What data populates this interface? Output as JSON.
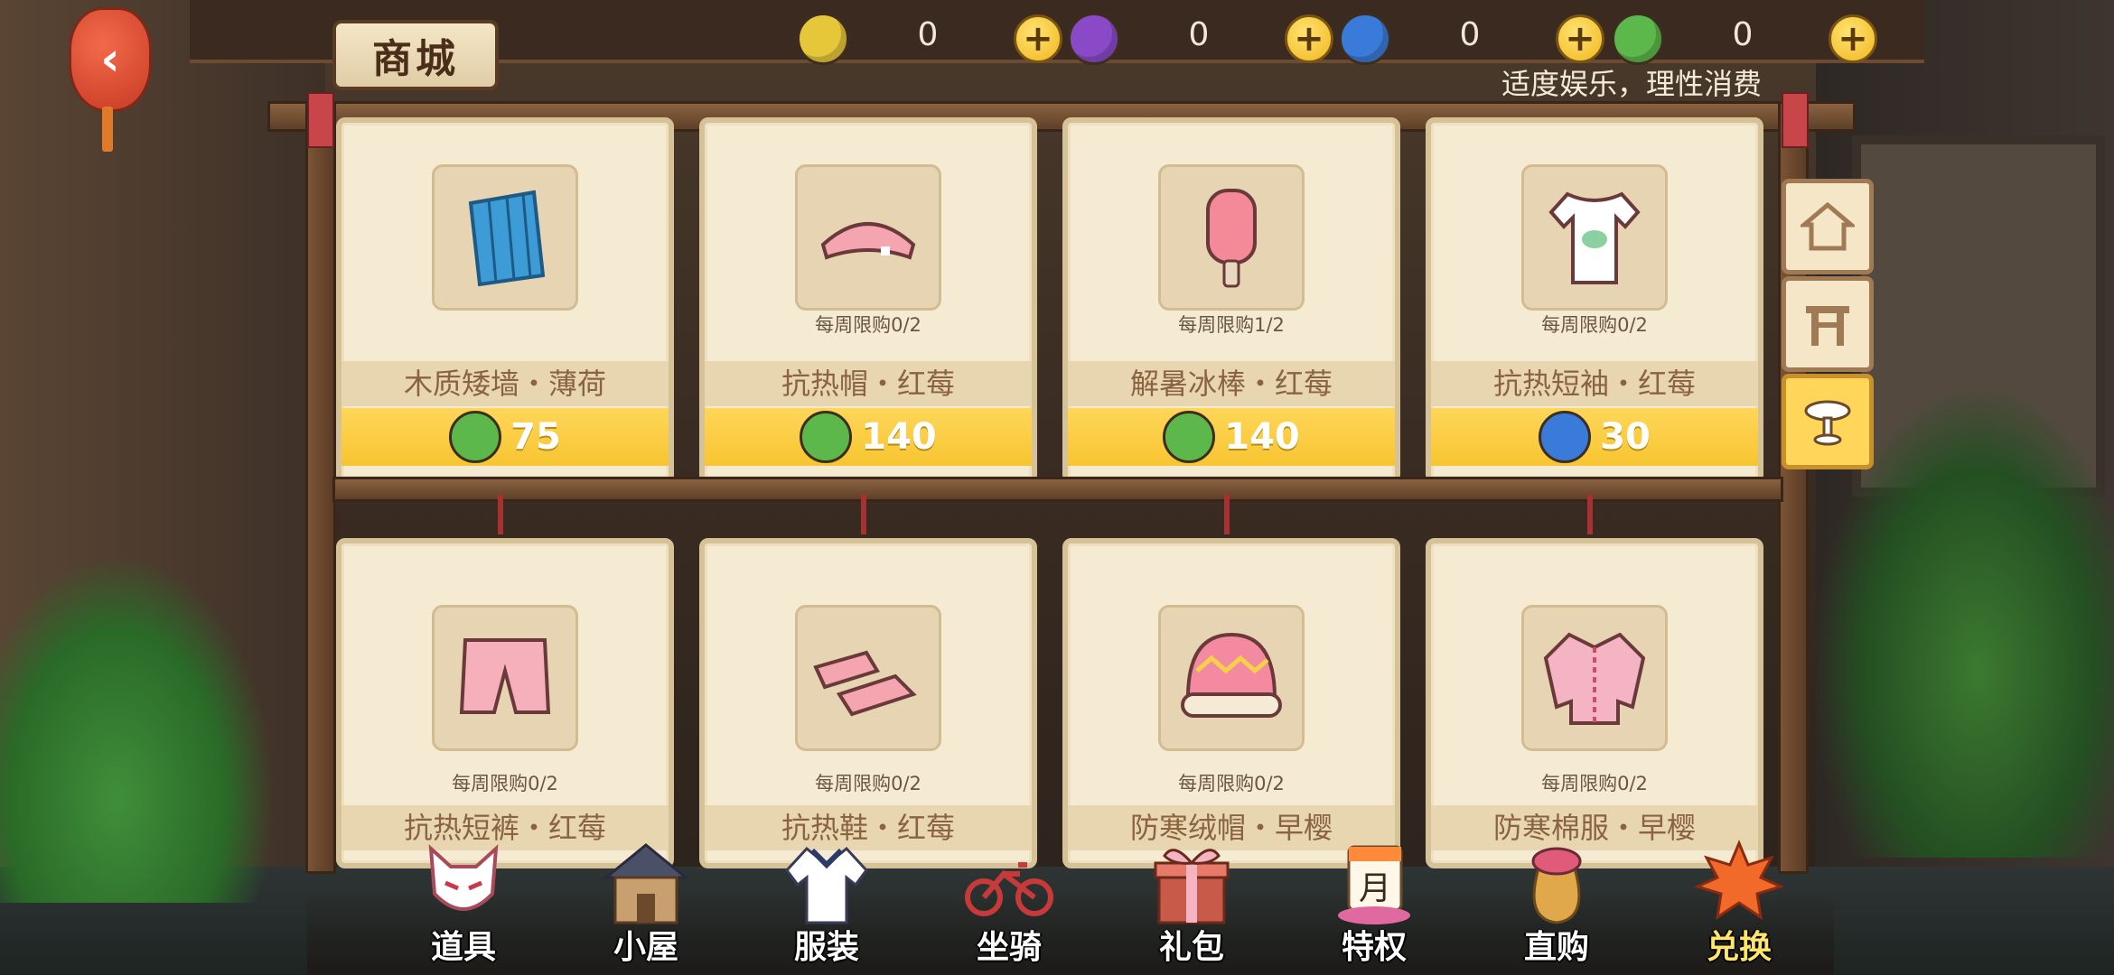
{
  "page_title": "商城",
  "notice": "适度娱乐，理性消费",
  "currencies": [
    {
      "name": "yellow-leaf",
      "color": "#e6c73a",
      "value": "0"
    },
    {
      "name": "purple-leaf",
      "color": "#8a4ac8",
      "value": "0"
    },
    {
      "name": "blue-leaf",
      "color": "#3a7ad8",
      "value": "0"
    },
    {
      "name": "green-leaf",
      "color": "#5cb84a",
      "value": "0"
    }
  ],
  "plus_label": "+",
  "back_label": "‹",
  "products_row1": [
    {
      "name": "木质矮墙・薄荷",
      "limit": "",
      "price": "75",
      "currency_color": "#5cb84a",
      "thumb_color": "#3d9bd6",
      "icon": "wall-icon"
    },
    {
      "name": "抗热帽・红莓",
      "limit": "每周限购0/2",
      "price": "140",
      "currency_color": "#5cb84a",
      "thumb_color": "#f4a5b0",
      "icon": "cap-icon"
    },
    {
      "name": "解暑冰棒・红莓",
      "limit": "每周限购1/2",
      "price": "140",
      "currency_color": "#5cb84a",
      "thumb_color": "#f4a5b0",
      "icon": "popsicle-icon"
    },
    {
      "name": "抗热短袖・红莓",
      "limit": "每周限购0/2",
      "price": "30",
      "currency_color": "#3a7ad8",
      "thumb_color": "#ffffff",
      "icon": "tshirt-icon"
    }
  ],
  "products_row2": [
    {
      "name": "抗热短裤・红莓",
      "limit": "每周限购0/2",
      "thumb_color": "#f6b0bc",
      "icon": "shorts-icon"
    },
    {
      "name": "抗热鞋・红莓",
      "limit": "每周限购0/2",
      "thumb_color": "#f4a5b0",
      "icon": "shoes-icon"
    },
    {
      "name": "防寒绒帽・早樱",
      "limit": "每周限购0/2",
      "thumb_color": "#f48aa0",
      "icon": "beanie-icon"
    },
    {
      "name": "防寒棉服・早樱",
      "limit": "每周限购0/2",
      "thumb_color": "#f4b4c4",
      "icon": "jacket-icon"
    }
  ],
  "side_tabs": [
    "house-icon",
    "gate-icon",
    "table-icon"
  ],
  "nav": [
    {
      "label": "道具",
      "icon": "fox-mask-icon"
    },
    {
      "label": "小屋",
      "icon": "cabin-icon"
    },
    {
      "label": "服装",
      "icon": "uniform-icon"
    },
    {
      "label": "坐骑",
      "icon": "bicycle-icon"
    },
    {
      "label": "礼包",
      "icon": "gift-box-icon"
    },
    {
      "label": "特权",
      "icon": "month-card-icon",
      "badge": "月"
    },
    {
      "label": "直购",
      "icon": "treasure-bag-icon"
    },
    {
      "label": "兑换",
      "icon": "maple-leaf-icon"
    }
  ],
  "colors": {
    "accent": "#ffd659",
    "card": "#f5ead2",
    "wood": "#5e4028"
  }
}
